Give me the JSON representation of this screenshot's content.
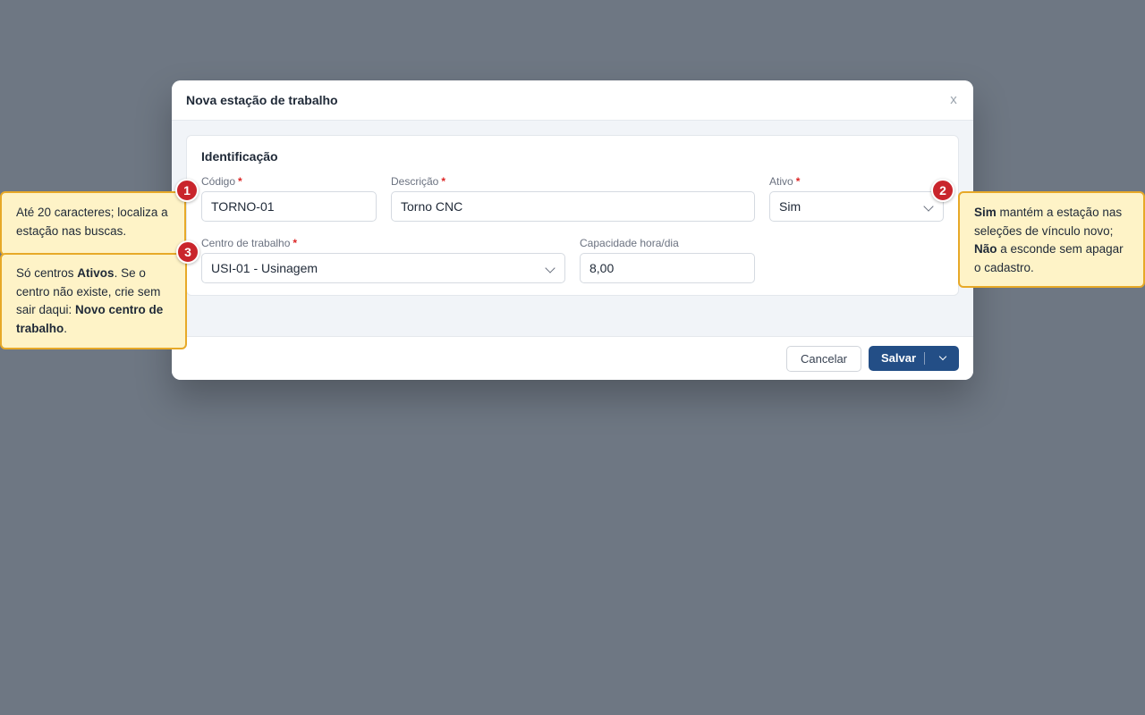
{
  "modal": {
    "title": "Nova estação de trabalho",
    "close_label": "x"
  },
  "section": {
    "title": "Identificação"
  },
  "fields": {
    "codigo": {
      "label": "Código",
      "required_mark": "*",
      "value": "TORNO-01"
    },
    "descricao": {
      "label": "Descrição",
      "required_mark": "*",
      "value": "Torno CNC"
    },
    "ativo": {
      "label": "Ativo",
      "required_mark": "*",
      "value": "Sim"
    },
    "centro": {
      "label": "Centro de trabalho",
      "required_mark": "*",
      "value": "USI-01 - Usinagem"
    },
    "capacidade": {
      "label": "Capacidade hora/dia",
      "value": "8,00"
    }
  },
  "footer": {
    "cancel_label": "Cancelar",
    "save_label": "Salvar"
  },
  "badges": [
    "1",
    "2",
    "3"
  ],
  "tooltips": {
    "tip1": {
      "text": "Até 20 caracteres; localiza a estação nas buscas."
    },
    "tip2": {
      "bold1": "Sim",
      "text1": " mantém a estação nas seleções de vínculo novo; ",
      "bold2": "Não",
      "text2": " a esconde sem apagar o cadastro."
    },
    "tip3": {
      "text1": "Só centros ",
      "bold1": "Ativos",
      "text2": ". Se o centro não existe, crie sem sair daqui: ",
      "bold2": "Novo centro de trabalho",
      "text3": "."
    }
  },
  "colors": {
    "backdrop": "#6e7783",
    "primary": "#234e86",
    "required": "#dc2626",
    "badge": "#c9252c",
    "tooltip_bg": "#fef3c7",
    "tooltip_border": "#e7a928"
  },
  "icons": {
    "close": "close-icon",
    "select_chevron": "chevron-down-icon"
  }
}
